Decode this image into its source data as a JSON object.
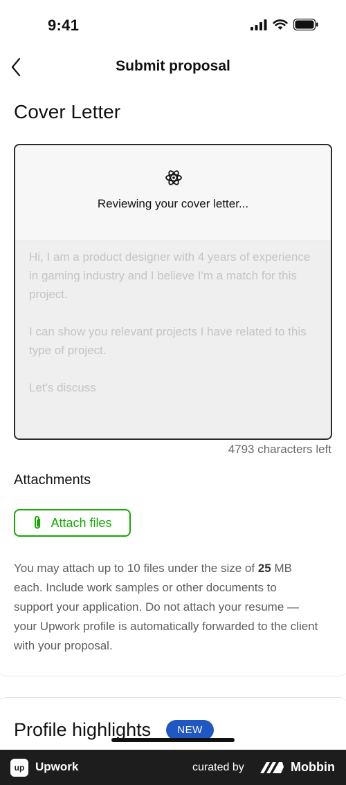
{
  "status_bar": {
    "time": "9:41"
  },
  "header": {
    "title": "Submit proposal"
  },
  "cover_letter": {
    "section_title": "Cover Letter",
    "review_status": "Reviewing your cover letter...",
    "text": "Hi, I am a product designer with 4 years of experience in gaming industry and I believe I'm a match for this project.\n\nI can show you relevant projects I have related to this type of project.\n\nLet's discuss",
    "chars_left": "4793 characters left"
  },
  "attachments": {
    "title": "Attachments",
    "button_label": "Attach files",
    "help_before": "You may attach up to 10 files under the size of ",
    "help_size": "25",
    "help_after": " MB each. Include work samples or other documents to support your application. Do not attach your resume — your Upwork profile is automatically forwarded to the client with your proposal."
  },
  "profile_highlights": {
    "title": "Profile highlights",
    "badge": "NEW"
  },
  "footer": {
    "app_name": "Upwork",
    "logo_text": "up",
    "curated_by": "curated by",
    "brand": "Mobbin"
  },
  "colors": {
    "accent": "#14a800",
    "badge": "#1f57c3",
    "footer_bg": "#1d1d1d"
  }
}
